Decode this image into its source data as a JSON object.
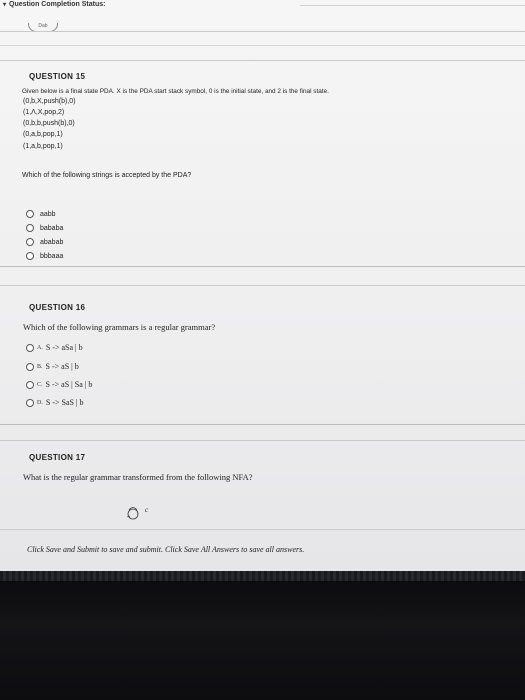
{
  "header": {
    "status_label": "Question Completion Status:",
    "chevron": "▾",
    "pill_text": "Dab"
  },
  "q15": {
    "title": "QUESTION 15",
    "intro": "Given below is a final state PDA. X is the PDA start stack symbol, 0 is the initial state, and 2 is the final state.",
    "transitions": [
      "(0,b,X,push(b),0)",
      "(1,Λ,X,pop,2)",
      "(0,b,b,push(b),0)",
      "(0,a,b,pop,1)",
      "(1,a,b,pop,1)"
    ],
    "question": "Which of the following strings is accepted by the PDA?",
    "options": [
      "aabb",
      "bababa",
      "ababab",
      "bbbaaa"
    ]
  },
  "q16": {
    "title": "QUESTION 16",
    "question": "Which of the following grammars is a regular grammar?",
    "options": [
      {
        "letter": "A.",
        "text": "S -> aSa | b"
      },
      {
        "letter": "B.",
        "text": "S -> aS | b"
      },
      {
        "letter": "C.",
        "text": "S -> aS | Sa | b"
      },
      {
        "letter": "D.",
        "text": "S -> SaS | b"
      }
    ]
  },
  "q17": {
    "title": "QUESTION 17",
    "question": "What is the regular grammar transformed from the following NFA?",
    "nfa_label": "c"
  },
  "footer": {
    "note": "Click Save and Submit to save and submit. Click Save All Answers to save all answers."
  }
}
